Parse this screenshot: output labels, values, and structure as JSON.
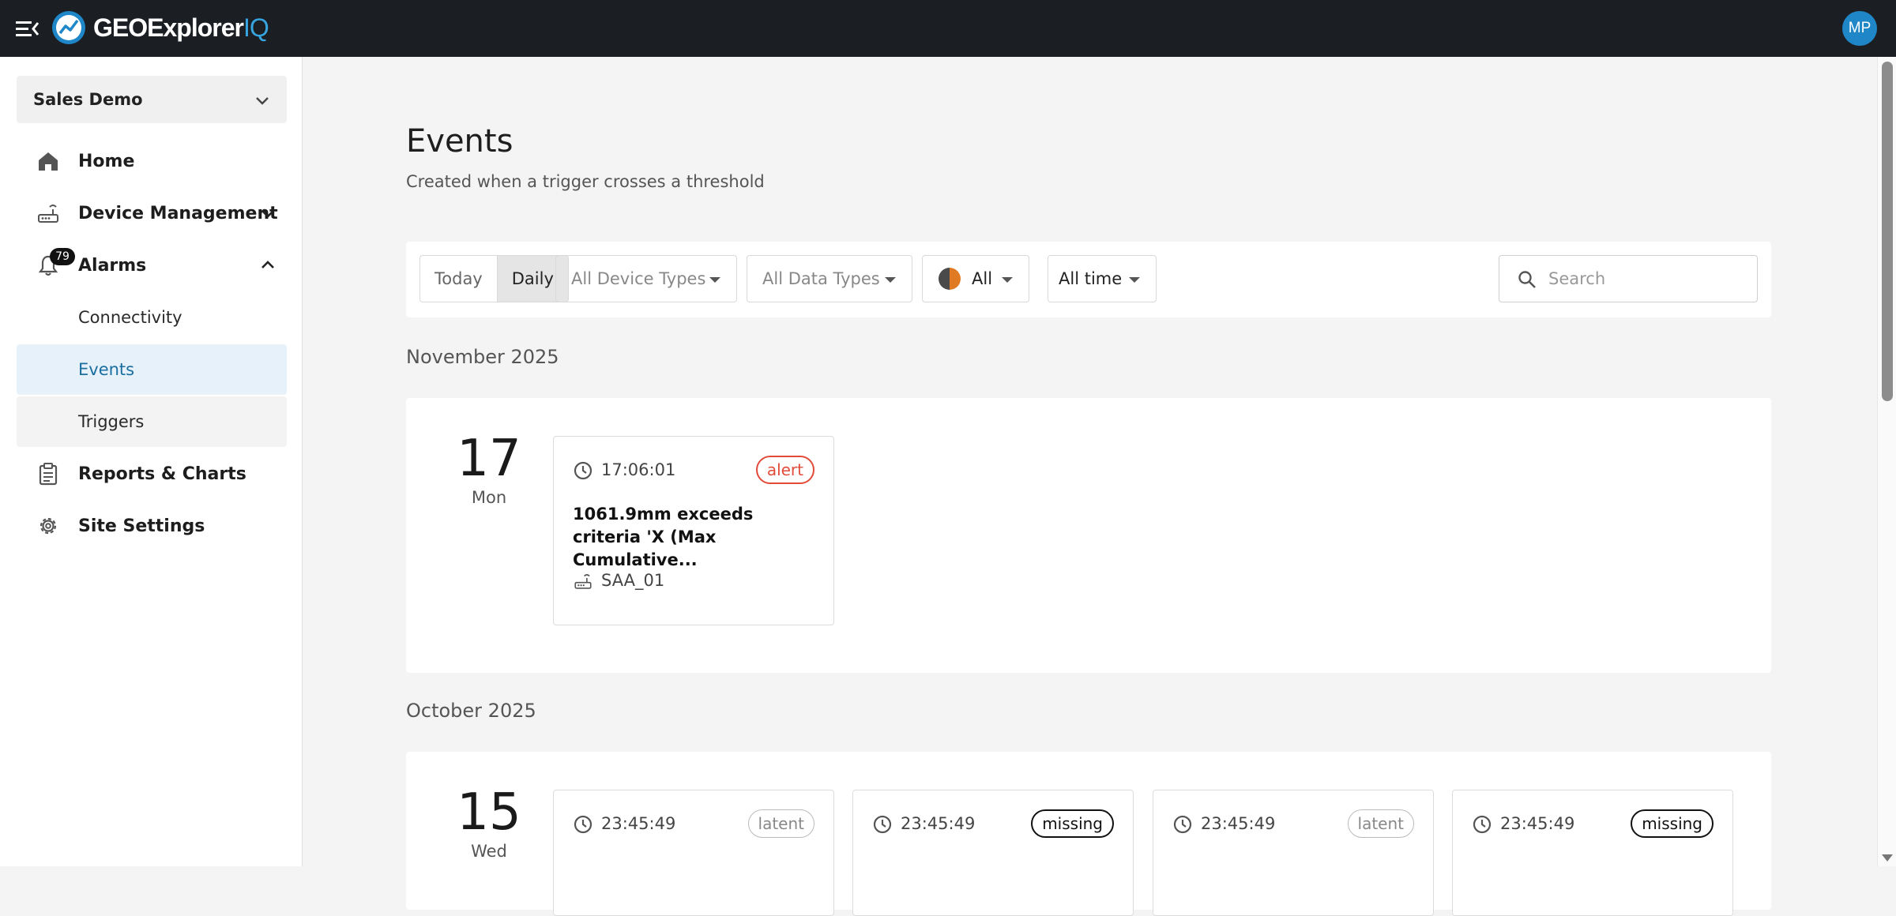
{
  "app": {
    "brand_main": "GEOExplorer",
    "brand_accent": "IQ",
    "accent_color": "#37a5e0"
  },
  "user": {
    "initials": "MP"
  },
  "sidebar": {
    "org": "Sales Demo",
    "items": {
      "home": "Home",
      "device_management": "Device Management",
      "alarms": "Alarms",
      "alarms_count": "79",
      "connectivity": "Connectivity",
      "events": "Events",
      "triggers": "Triggers",
      "reports": "Reports & Charts",
      "site_settings": "Site Settings"
    }
  },
  "page": {
    "title": "Events",
    "subtitle": "Created when a trigger crosses a threshold"
  },
  "filters": {
    "today": "Today",
    "daily": "Daily",
    "device_types": "All Device Types",
    "data_types": "All Data Types",
    "status": "All",
    "time": "All time",
    "search_placeholder": "Search"
  },
  "groups": [
    {
      "month": "November 2025",
      "day": "17",
      "weekday": "Mon",
      "events": [
        {
          "time": "17:06:01",
          "tag": "alert",
          "desc": "1061.9mm exceeds criteria 'X (Max Cumulative...",
          "device": "SAA_01"
        }
      ]
    },
    {
      "month": "October 2025",
      "day": "15",
      "weekday": "Wed",
      "events": [
        {
          "time": "23:45:49",
          "tag": "latent",
          "desc": "",
          "device": ""
        },
        {
          "time": "23:45:49",
          "tag": "missing",
          "desc": "",
          "device": ""
        },
        {
          "time": "23:45:49",
          "tag": "latent",
          "desc": "",
          "device": ""
        },
        {
          "time": "23:45:49",
          "tag": "missing",
          "desc": "",
          "device": ""
        }
      ]
    }
  ]
}
